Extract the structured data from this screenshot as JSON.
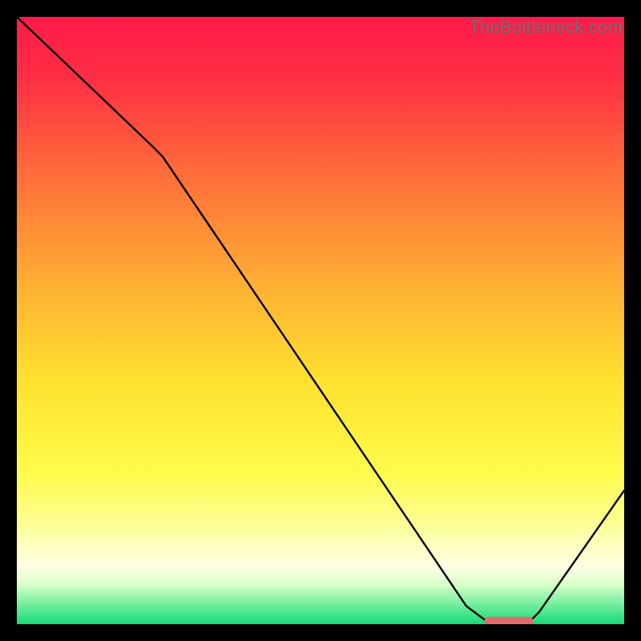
{
  "watermark": "TheBottleneck.com",
  "colors": {
    "gradient_stops": [
      {
        "offset": 0.0,
        "color": "#ff1a49"
      },
      {
        "offset": 0.1,
        "color": "#ff2e44"
      },
      {
        "offset": 0.25,
        "color": "#ff6a3a"
      },
      {
        "offset": 0.45,
        "color": "#ffb233"
      },
      {
        "offset": 0.6,
        "color": "#ffe12f"
      },
      {
        "offset": 0.75,
        "color": "#fffb4a"
      },
      {
        "offset": 0.84,
        "color": "#fdff9a"
      },
      {
        "offset": 0.905,
        "color": "#ffffe6"
      },
      {
        "offset": 0.935,
        "color": "#d8ffc8"
      },
      {
        "offset": 0.965,
        "color": "#7af0a0"
      },
      {
        "offset": 1.0,
        "color": "#17d977"
      }
    ],
    "curve": "#000000",
    "marker": "#e26a6a"
  },
  "chart_data": {
    "type": "line",
    "title": "",
    "xlabel": "",
    "ylabel": "",
    "xlim": [
      0,
      100
    ],
    "ylim": [
      0,
      100
    ],
    "series": [
      {
        "name": "bottleneck-curve",
        "x": [
          0,
          22,
          24,
          74,
          78,
          84,
          86,
          100
        ],
        "y": [
          100,
          79,
          77,
          3,
          0,
          0,
          2,
          22
        ]
      }
    ],
    "marker": {
      "name": "optimal-zone",
      "x_start": 77,
      "x_end": 85,
      "y": 0.5
    }
  }
}
